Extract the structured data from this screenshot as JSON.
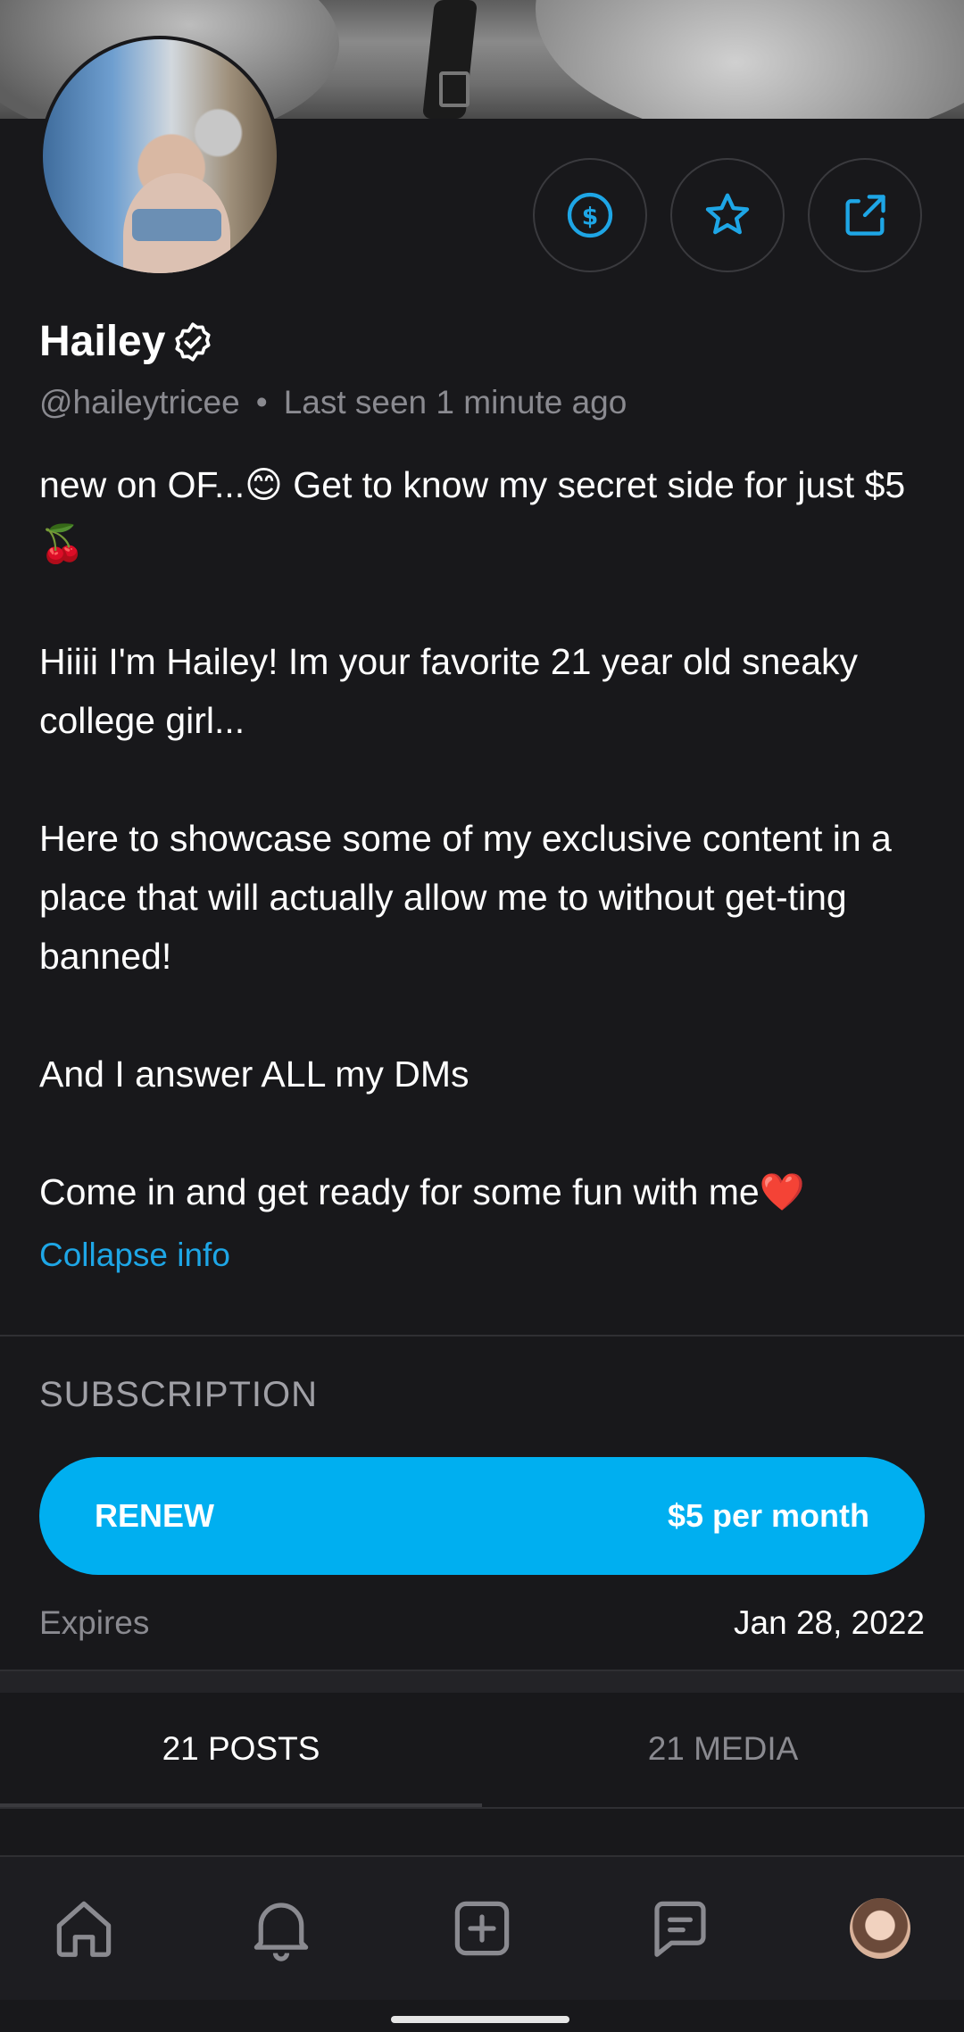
{
  "profile": {
    "name": "Hailey",
    "username": "@haileytricee",
    "separator": "•",
    "last_seen": "Last seen 1 minute ago",
    "bio": [
      "new on OF...😊 Get to know my secret side for just $5🍒",
      "Hiiii I'm Hailey! Im your favorite 21 year old sneaky college girl...",
      "Here to showcase some of my exclusive content in a place that will actually allow me to without get-ting banned!",
      "And I answer ALL my DMs",
      "Come in and get ready for some fun with me❤️"
    ],
    "collapse_label": "Collapse info"
  },
  "actions": {
    "tip_icon": "dollar-circle-icon",
    "favorite_icon": "star-icon",
    "share_icon": "share-icon"
  },
  "subscription": {
    "title": "SUBSCRIPTION",
    "button_label": "RENEW",
    "price": "$5 per month",
    "expires_label": "Expires",
    "expires_date": "Jan 28, 2022"
  },
  "tabs": [
    {
      "label": "21 POSTS",
      "active": true
    },
    {
      "label": "21 MEDIA",
      "active": false
    }
  ],
  "bottom_nav": [
    "home-icon",
    "bell-icon",
    "add-post-icon",
    "messages-icon",
    "profile-avatar"
  ],
  "colors": {
    "accent": "#00aff0",
    "background": "#18181b",
    "muted_text": "#8a8a90"
  }
}
